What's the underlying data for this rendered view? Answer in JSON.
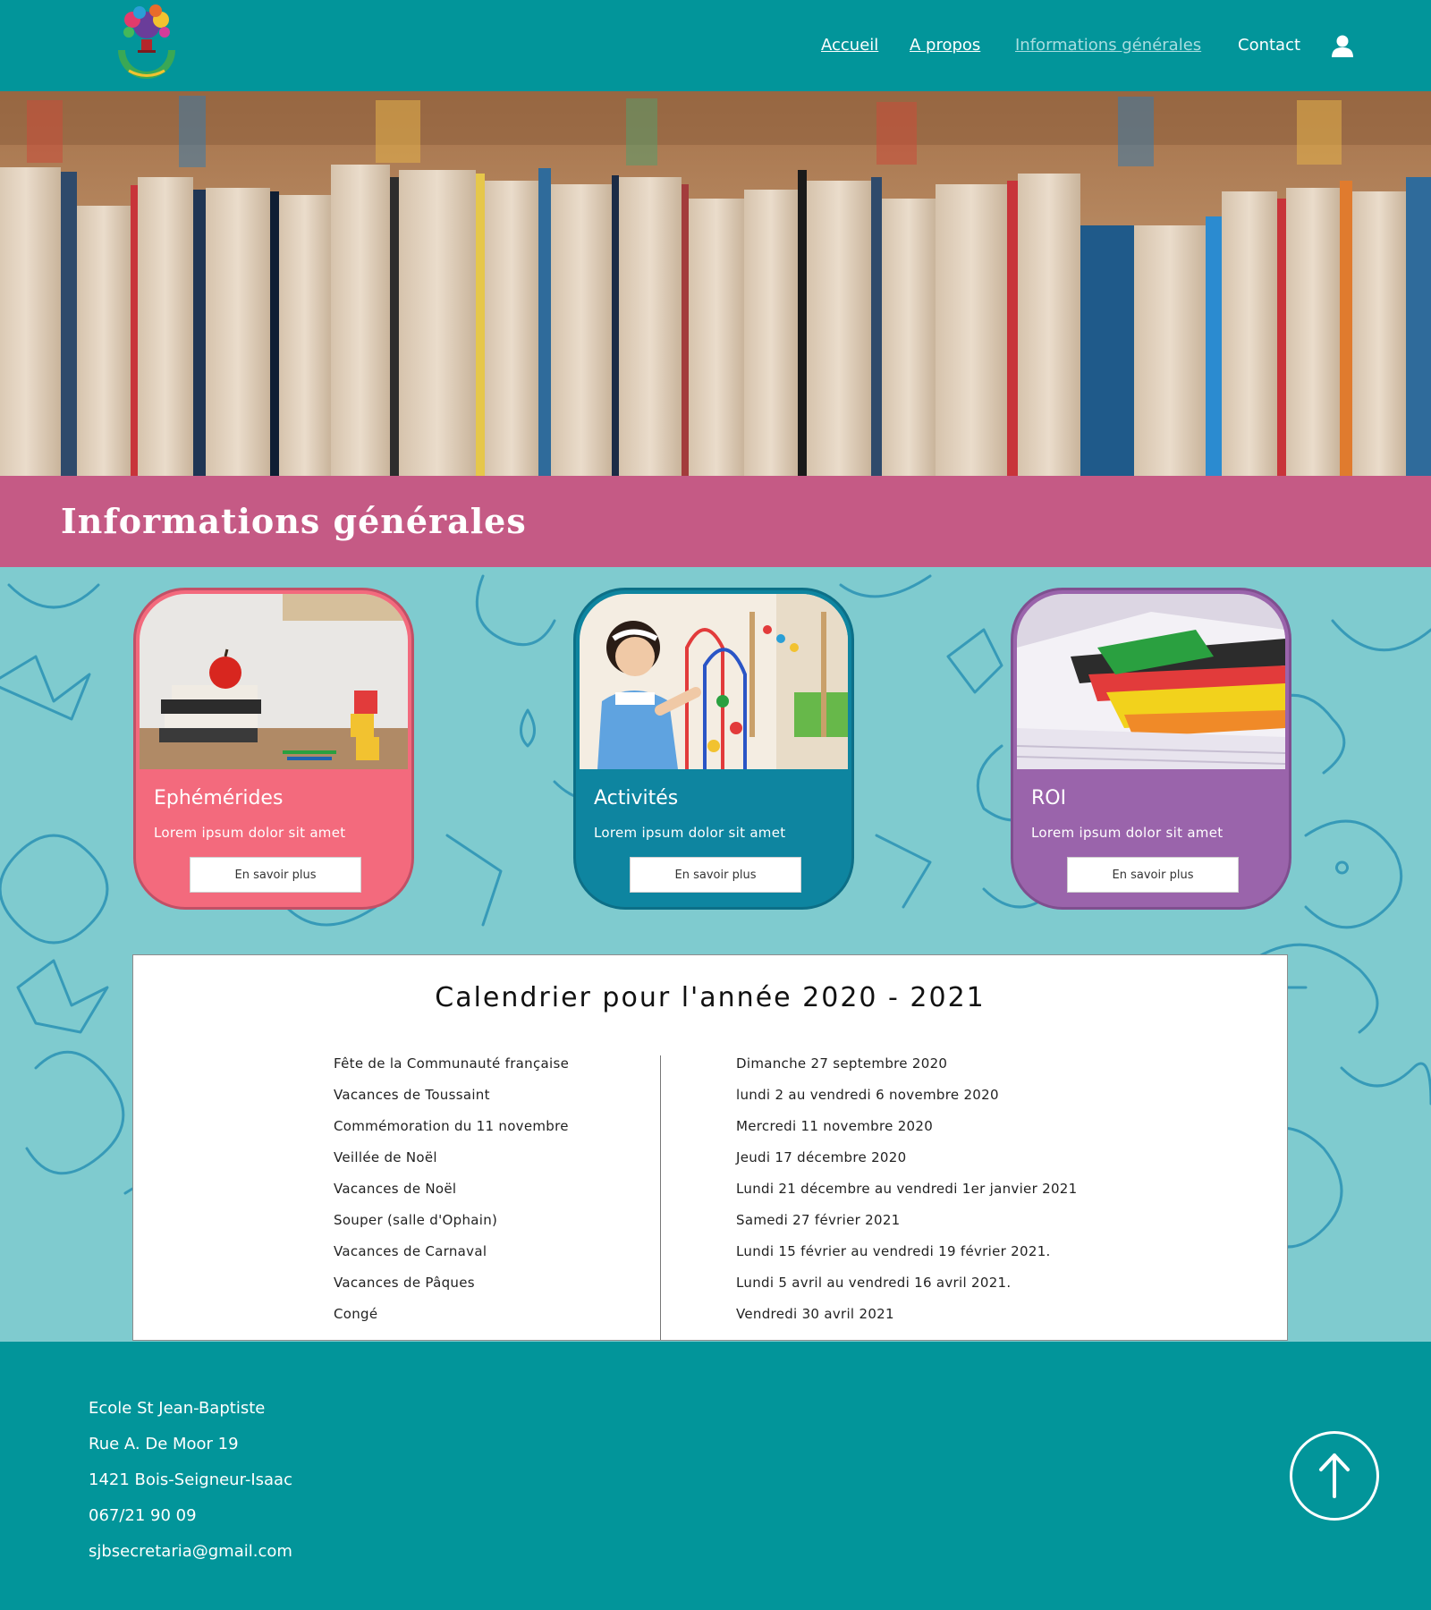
{
  "nav": {
    "items": [
      {
        "label": "Accueil",
        "state": "link"
      },
      {
        "label": "A propos",
        "state": "link"
      },
      {
        "label": "Informations générales",
        "state": "active"
      },
      {
        "label": "Contact",
        "state": "plain"
      }
    ],
    "user_icon": "user-icon"
  },
  "page_title": "Informations générales",
  "cards": [
    {
      "title": "Ephémérides",
      "text": "Lorem ipsum dolor sit amet",
      "button": "En savoir plus",
      "color": "#f36a7d",
      "image": "apple-books-image"
    },
    {
      "title": "Activités",
      "text": "Lorem ipsum dolor sit amet",
      "button": "En savoir plus",
      "color": "#0e85a0",
      "image": "child-playing-image"
    },
    {
      "title": "ROI",
      "text": "Lorem ipsum dolor sit amet",
      "button": "En savoir plus",
      "color": "#9a64ab",
      "image": "papers-stack-image"
    }
  ],
  "calendar": {
    "title": "Calendrier pour l'année 2020 - 2021",
    "events": [
      "Fête de la Communauté française",
      "Vacances de Toussaint",
      "Commémoration du 11 novembre",
      "Veillée de Noël",
      "Vacances de Noël",
      "Souper (salle d'Ophain)",
      "Vacances de Carnaval",
      "Vacances de Pâques",
      "Congé"
    ],
    "dates": [
      "Dimanche 27 septembre 2020",
      "lundi 2 au vendredi 6 novembre 2020",
      "Mercredi 11 novembre 2020",
      "Jeudi 17 décembre 2020",
      "Lundi 21 décembre au vendredi 1er janvier 2021",
      "Samedi 27 février 2021",
      "Lundi 15 février au vendredi 19 février 2021.",
      "Lundi 5 avril au vendredi 16 avril 2021.",
      "Vendredi 30 avril 2021"
    ]
  },
  "footer": {
    "lines": [
      "Ecole St Jean-Baptiste",
      "Rue A. De Moor 19",
      "1421 Bois-Seigneur-Isaac",
      "067/21 90 09",
      "sjbsecretaria@gmail.com"
    ],
    "top_button_icon": "arrow-up-icon"
  },
  "colors": {
    "header": "#02959a",
    "title_band": "#c55a85",
    "pattern_bg": "#7fcbcf",
    "footer": "#02959a"
  }
}
